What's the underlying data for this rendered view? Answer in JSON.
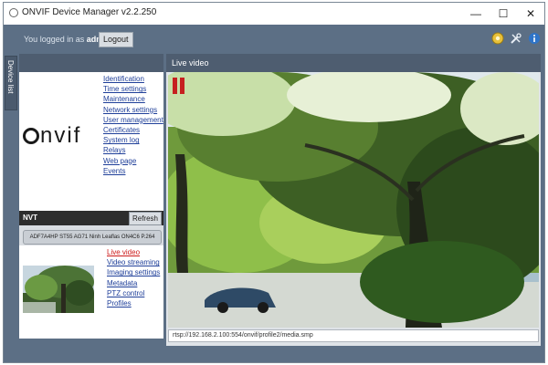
{
  "window": {
    "title": "ONVIF Device Manager v2.2.250",
    "controls": {
      "minimize": "—",
      "maximize": "☐",
      "close": "✕"
    }
  },
  "toolbar": {
    "login_prefix": "You logged in as",
    "username": "admin",
    "logout_label": "Logout",
    "icons": [
      "settings-icon",
      "tools-icon",
      "info-icon"
    ]
  },
  "side_tab": {
    "label": "Device list"
  },
  "identity": {
    "logo_text": "nvif",
    "menu": [
      "Identification",
      "Time settings",
      "Maintenance",
      "Network settings",
      "User management",
      "Certificates",
      "System log",
      "Relays",
      "Web page",
      "Events"
    ]
  },
  "device_bar": {
    "name": "NVT",
    "refresh_label": "Refresh"
  },
  "device_item": {
    "label": "ADF7A4HP ST55 AG71 Ninh Leaflas ON4C6 P.264"
  },
  "device_menu": {
    "items": [
      {
        "label": "Live video",
        "active": true
      },
      {
        "label": "Video streaming",
        "active": false
      },
      {
        "label": "Imaging settings",
        "active": false
      },
      {
        "label": "Metadata",
        "active": false
      },
      {
        "label": "PTZ control",
        "active": false
      },
      {
        "label": "Profiles",
        "active": false
      }
    ]
  },
  "live_video": {
    "header": "Live video",
    "stream_url": "rtsp://192.168.2.100:554/onvif/profile2/media.smp"
  },
  "colors": {
    "window_bg": "#5c6f85",
    "panel_header": "#4e5d70",
    "link": "#1f3f99",
    "active_link": "#cc1a1a",
    "pause": "#c62020"
  }
}
